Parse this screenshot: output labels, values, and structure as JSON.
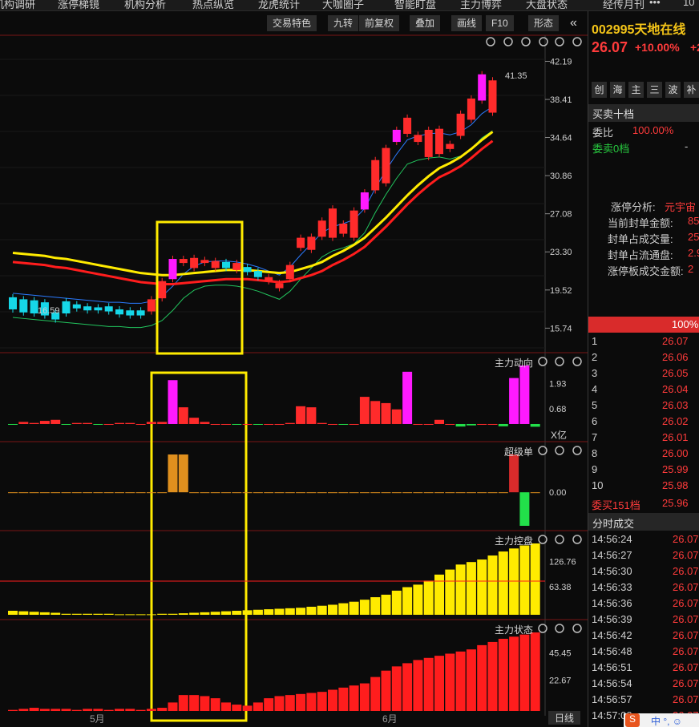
{
  "top_nav": [
    "机构调研",
    "涨停梯镜",
    "机构分析",
    "热点纵览",
    "龙虎统计",
    "大咖圈子",
    "智能盯盘",
    "主力博弈",
    "大盘状态",
    "经传月刊",
    "•••",
    "10"
  ],
  "toolbar": {
    "items": [
      "交易特色",
      "九转",
      "前复权",
      "叠加",
      "画线",
      "F10",
      "形态"
    ],
    "collapse_icon": "double-chevron-left-icon"
  },
  "stock": {
    "code_name": "002995天地在线",
    "price": "26.07",
    "change": "+10.00%",
    "change2": "+2",
    "tags": [
      "创",
      "海",
      "主",
      "三",
      "波",
      "补"
    ]
  },
  "right_panel": {
    "depth_title": "买卖十档",
    "weibi_label": "委比",
    "weibi_value": "100.00%",
    "ask_label": "委卖0档",
    "ask_value": "-",
    "limit_analysis_label": "涨停分析:",
    "limit_analysis_value": "元宇宙",
    "limit_rows": [
      {
        "label": "当前封单金额:",
        "value": "85"
      },
      {
        "label": "封单占成交量:",
        "value": "25"
      },
      {
        "label": "封单占流通盘:",
        "value": "2.9"
      },
      {
        "label": "涨停板成交金额:",
        "value": "2"
      }
    ],
    "bid_bar_pct": "100%",
    "bids": [
      {
        "n": "1",
        "p": "26.07"
      },
      {
        "n": "2",
        "p": "26.06"
      },
      {
        "n": "3",
        "p": "26.05"
      },
      {
        "n": "4",
        "p": "26.04"
      },
      {
        "n": "5",
        "p": "26.03"
      },
      {
        "n": "6",
        "p": "26.02"
      },
      {
        "n": "7",
        "p": "26.01"
      },
      {
        "n": "8",
        "p": "26.00"
      },
      {
        "n": "9",
        "p": "25.99"
      },
      {
        "n": "10",
        "p": "25.98"
      }
    ],
    "bid_total_label": "委买151档",
    "bid_total_value": "25.96",
    "ticks_title": "分时成交",
    "ticks": [
      {
        "t": "14:56:24",
        "p": "26.07"
      },
      {
        "t": "14:56:27",
        "p": "26.07"
      },
      {
        "t": "14:56:30",
        "p": "26.07"
      },
      {
        "t": "14:56:33",
        "p": "26.07"
      },
      {
        "t": "14:56:36",
        "p": "26.07"
      },
      {
        "t": "14:56:39",
        "p": "26.07"
      },
      {
        "t": "14:56:42",
        "p": "26.07"
      },
      {
        "t": "14:56:48",
        "p": "26.07"
      },
      {
        "t": "14:56:51",
        "p": "26.07"
      },
      {
        "t": "14:56:54",
        "p": "26.07"
      },
      {
        "t": "14:56:57",
        "p": "26.07"
      },
      {
        "t": "14:57:00",
        "p": "26.07"
      }
    ],
    "ime": "中 °, ☺"
  },
  "sections": {
    "flow": "主力动向",
    "super": "超级单",
    "control": "主力控盘",
    "state": "主力状态",
    "unit": "X亿",
    "period": "日线"
  },
  "x_labels": [
    "5月",
    "6月"
  ],
  "chart_data": [
    {
      "type": "candlestick",
      "yticks": [
        "42.19",
        "38.41",
        "34.64",
        "30.86",
        "27.08",
        "23.30",
        "19.52",
        "15.74"
      ],
      "ylim": [
        14.5,
        43.5
      ],
      "annotations": [
        "41.35",
        "16.59"
      ],
      "candles": [
        [
          18.8,
          17.6
        ],
        [
          18.6,
          17.3
        ],
        [
          18.5,
          17.2
        ],
        [
          18.3,
          17.0
        ],
        [
          17.3,
          16.6
        ],
        [
          18.4,
          17.2
        ],
        [
          18.1,
          17.7
        ],
        [
          17.9,
          17.5
        ],
        [
          17.8,
          17.5
        ],
        [
          17.9,
          17.4
        ],
        [
          17.6,
          17.1
        ],
        [
          17.5,
          17.0
        ],
        [
          17.5,
          17.0
        ],
        [
          18.6,
          17.4
        ],
        [
          20.4,
          18.7
        ],
        [
          22.6,
          20.6
        ],
        [
          22.6,
          22.2
        ],
        [
          22.7,
          21.7
        ],
        [
          22.5,
          22.2
        ],
        [
          22.4,
          21.7
        ],
        [
          22.3,
          21.7
        ],
        [
          22.2,
          21.5
        ],
        [
          21.8,
          21.3
        ],
        [
          21.4,
          20.8
        ],
        [
          20.8,
          20.4
        ],
        [
          20.2,
          19.7
        ],
        [
          22.0,
          20.6
        ],
        [
          24.7,
          23.7
        ],
        [
          24.8,
          23.5
        ],
        [
          26.4,
          24.8
        ],
        [
          27.6,
          24.7
        ],
        [
          26.1,
          25.1
        ],
        [
          27.4,
          24.7
        ],
        [
          29.2,
          27.5
        ],
        [
          32.4,
          29.4
        ],
        [
          33.6,
          30.1
        ],
        [
          35.4,
          34.2
        ],
        [
          36.6,
          35.0
        ],
        [
          34.9,
          34.2
        ],
        [
          35.4,
          32.7
        ],
        [
          35.5,
          33.0
        ],
        [
          34.0,
          33.5
        ],
        [
          37.0,
          34.8
        ],
        [
          38.5,
          36.4
        ],
        [
          40.9,
          38.3
        ],
        [
          40.3,
          37.1
        ]
      ],
      "ma_fast": [
        18.6,
        18.5,
        18.4,
        18.3,
        18.2,
        18.1,
        18.0,
        17.9,
        17.8,
        17.7,
        17.7,
        17.6,
        17.6,
        17.8,
        18.3,
        19.3,
        20.5,
        21.3,
        21.7,
        21.8,
        21.8,
        21.7,
        21.5,
        21.2,
        20.8,
        20.4,
        21.2,
        22.4,
        23.5,
        24.6,
        25.2,
        25.5,
        25.9,
        27.0,
        29.0,
        30.8,
        32.4,
        33.8,
        34.2,
        34.4,
        34.5,
        34.3,
        34.6,
        35.3,
        36.4,
        37.1
      ],
      "ma_slow": [
        22.5,
        22.4,
        22.3,
        22.2,
        22.0,
        21.9,
        21.7,
        21.5,
        21.3,
        21.1,
        20.9,
        20.7,
        20.5,
        20.4,
        20.3,
        20.3,
        20.4,
        20.5,
        20.6,
        20.7,
        20.8,
        20.8,
        20.8,
        20.7,
        20.6,
        20.5,
        20.6,
        20.9,
        21.2,
        21.6,
        22.2,
        22.7,
        23.3,
        24.0,
        25.0,
        26.0,
        27.1,
        28.2,
        29.2,
        30.1,
        30.9,
        31.4,
        32.0,
        32.8,
        33.7,
        34.5
      ]
    },
    {
      "type": "bar",
      "name": "主力动向",
      "yticks": [
        "1.93",
        "0.68"
      ],
      "values": [
        -0.1,
        0.1,
        0.05,
        0.15,
        0.2,
        -0.15,
        0.05,
        0.05,
        -0.1,
        0,
        0.05,
        0.05,
        0,
        0.1,
        0.1,
        2.1,
        0.8,
        0.3,
        0.1,
        0,
        0,
        -0.05,
        0,
        -0.05,
        0,
        0,
        0.05,
        0.85,
        0.8,
        0.05,
        0,
        -0.1,
        0,
        1.3,
        1.1,
        1.0,
        0.7,
        2.5,
        0,
        0,
        0.2,
        0,
        -0.55,
        -0.3,
        0,
        0,
        -0.5,
        2.2,
        2.8,
        -0.6
      ]
    },
    {
      "type": "bar",
      "name": "超级单",
      "yticks": [
        "0.00"
      ],
      "values": [
        0,
        0,
        0,
        0,
        0,
        0,
        0,
        0,
        0,
        0,
        0,
        0,
        0,
        0,
        0,
        1.0,
        1.0,
        0,
        0,
        0,
        0,
        0,
        0,
        0,
        0,
        0,
        0,
        0,
        0,
        0,
        0,
        0,
        0,
        0,
        0,
        0,
        0,
        0,
        0,
        0,
        0,
        0,
        0,
        0,
        0,
        0,
        0,
        1.0,
        -1.0,
        0
      ]
    },
    {
      "type": "bar",
      "name": "主力控盘",
      "yticks": [
        "126.76",
        "63.38"
      ],
      "values": [
        8,
        7,
        6,
        5,
        4,
        2,
        2,
        2,
        2,
        2,
        1,
        1,
        1,
        1,
        2,
        2,
        3,
        4,
        5,
        6,
        7,
        8,
        9,
        10,
        11,
        12,
        13,
        14,
        16,
        18,
        20,
        23,
        26,
        30,
        35,
        40,
        48,
        55,
        60,
        68,
        80,
        90,
        100,
        105,
        110,
        118,
        126,
        132,
        138,
        142
      ]
    },
    {
      "type": "bar",
      "name": "主力状态",
      "yticks": [
        "45.45",
        "22.67"
      ],
      "values": [
        1,
        2,
        3,
        2,
        2,
        2,
        1,
        2,
        2,
        1,
        2,
        2,
        1,
        2,
        3,
        8,
        15,
        15,
        14,
        12,
        8,
        6,
        5,
        8,
        12,
        14,
        15,
        16,
        17,
        18,
        20,
        22,
        24,
        26,
        32,
        38,
        42,
        45,
        48,
        50,
        52,
        54,
        56,
        58,
        62,
        65,
        68,
        70,
        72,
        74
      ]
    }
  ]
}
